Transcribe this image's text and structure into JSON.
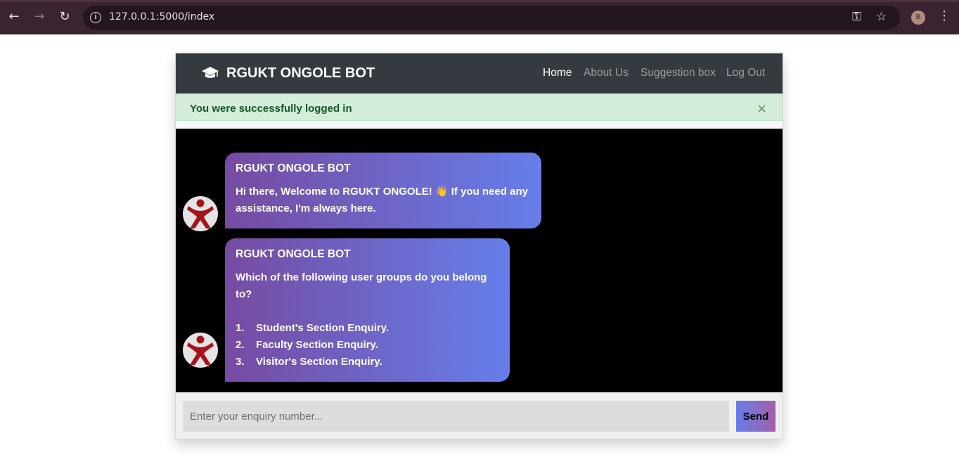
{
  "browser": {
    "url": "127.0.0.1:5000/index",
    "profile_initial": "B",
    "icons": {
      "back": "back-arrow-icon",
      "forward": "forward-arrow-icon",
      "reload": "reload-icon",
      "site_info": "info-icon",
      "password": "key-icon",
      "bookmark": "star-icon",
      "menu": "kebab-menu-icon"
    }
  },
  "navbar": {
    "brand": "RGUKT ONGOLE BOT",
    "brand_icon": "graduation-cap-icon",
    "links": [
      {
        "label": "Home",
        "active": true
      },
      {
        "label": "About Us",
        "active": false
      },
      {
        "label": "Suggestion box",
        "active": false
      },
      {
        "label": "Log Out",
        "active": false
      }
    ]
  },
  "alert": {
    "message": "You were successfully logged in",
    "close": "×",
    "color": "#d4eddb"
  },
  "chat": {
    "messages": [
      {
        "sender": "RGUKT ONGOLE BOT",
        "text": "Hi there, Welcome to RGUKT ONGOLE! 👋 If you need any assistance, I'm always here."
      },
      {
        "sender": "RGUKT ONGOLE BOT",
        "text": "Which of the following user groups do you belong to?",
        "options": [
          {
            "num": "1.",
            "label": "Student's Section Enquiry."
          },
          {
            "num": "2.",
            "label": "Faculty Section Enquiry."
          },
          {
            "num": "3.",
            "label": "Visitor's Section Enquiry."
          }
        ]
      }
    ],
    "bubble_gradient": [
      "#764ba2",
      "#667eea"
    ]
  },
  "input": {
    "placeholder": "Enter your enquiry number...",
    "value": "",
    "send_label": "Send"
  }
}
